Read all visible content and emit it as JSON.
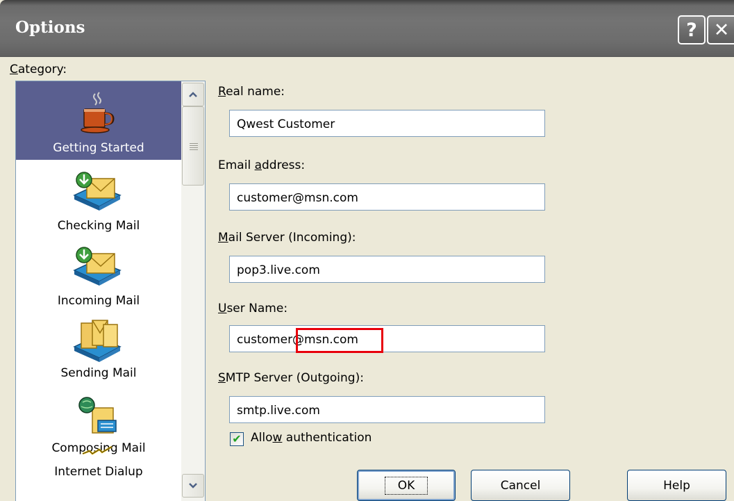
{
  "window": {
    "title": "Options",
    "help_glyph": "?",
    "close_glyph": "✕"
  },
  "category": {
    "label_accel": "C",
    "label_rest": "ategory:",
    "items": [
      {
        "label": "Getting Started",
        "icon": "coffee-cup-icon",
        "selected": true
      },
      {
        "label": "Checking Mail",
        "icon": "checking-mail-icon",
        "selected": false
      },
      {
        "label": "Incoming Mail",
        "icon": "incoming-mail-icon",
        "selected": false
      },
      {
        "label": "Sending Mail",
        "icon": "sending-mail-icon",
        "selected": false
      },
      {
        "label": "Composing Mail",
        "icon": "composing-mail-icon",
        "selected": false
      },
      {
        "label": "Internet Dialup",
        "icon": "dialup-lightning-icon",
        "selected": false
      }
    ]
  },
  "fields": {
    "real_name": {
      "accel": "R",
      "rest": "eal name:",
      "value": "Qwest Customer"
    },
    "email": {
      "pre": "Email ",
      "accel": "a",
      "rest": "ddress:",
      "value": "customer@msn.com"
    },
    "incoming": {
      "accel": "M",
      "rest": "ail Server (Incoming):",
      "value": "pop3.live.com"
    },
    "user_name": {
      "accel": "U",
      "rest": "ser Name:",
      "value": "customer@msn.com"
    },
    "smtp": {
      "accel": "S",
      "rest": "MTP Server (Outgoing):",
      "value": "smtp.live.com"
    }
  },
  "auth": {
    "pre": "Allo",
    "accel": "w",
    "rest": " authentication",
    "checked": true,
    "check_glyph": "✔"
  },
  "buttons": {
    "ok": "OK",
    "cancel": "Cancel",
    "help": "Help"
  },
  "colors": {
    "selection": "#5A5F90",
    "highlight_box": "#E8000B",
    "checkmark": "#21A121"
  }
}
